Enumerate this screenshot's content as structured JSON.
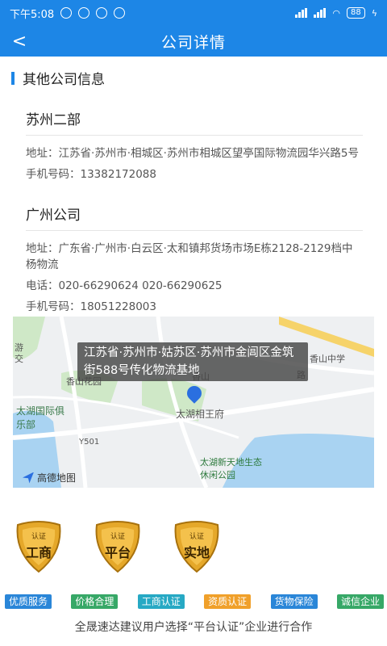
{
  "status_bar": {
    "time": "下午5:08",
    "battery": "88"
  },
  "header": {
    "back_label": "<",
    "title": "公司详情"
  },
  "section_title": "其他公司信息",
  "companies": [
    {
      "name": "苏州二部",
      "address_label": "地址：",
      "address": "江苏省·苏州市·相城区·苏州市相城区望亭国际物流园华兴路5号",
      "mobile_label": "手机号码：",
      "mobile": "13382172088"
    },
    {
      "name": "广州公司",
      "address_label": "地址：",
      "address": "广东省·广州市·白云区·太和镇邦货场市场E栋2128-2129档中杨物流",
      "phone_label": "电话：",
      "phone": "020-66290624 020-66290625",
      "mobile_label": "手机号码：",
      "mobile": "18051228003"
    }
  ],
  "map": {
    "bubble_text": "江苏省·苏州市·姑苏区·苏州市金阊区金筑街588号传化物流基地",
    "labels": {
      "xiangshan_garden": "香山花园",
      "xiangshan_school": "香山中学",
      "xiangwang": "太湖相王府",
      "club": "太湖国际俱乐部",
      "park": "太湖新天地生态休闲公园",
      "road": "Y501",
      "you": "游",
      "jiao": "交",
      "lu": "路",
      "xiangshan": "香山"
    },
    "logo_text": "高德地图",
    "colors": {
      "water": "#a9d3f2",
      "land": "#eef0f2",
      "green": "#cfe8c7",
      "road": "#ffffff",
      "highway": "#f6d36a"
    }
  },
  "badges": [
    {
      "top": "认证",
      "main": "工商"
    },
    {
      "top": "认证",
      "main": "平台"
    },
    {
      "top": "认证",
      "main": "实地"
    }
  ],
  "tags": [
    {
      "label": "优质服务",
      "color": "#2a86d8"
    },
    {
      "label": "价格合理",
      "color": "#37a867"
    },
    {
      "label": "工商认证",
      "color": "#27a9c4"
    },
    {
      "label": "资质认证",
      "color": "#f0a02a"
    },
    {
      "label": "货物保险",
      "color": "#2a86d8"
    },
    {
      "label": "诚信企业",
      "color": "#37a867"
    }
  ],
  "footer_note": "全晟速达建议用户选择“平台认证”企业进行合作",
  "accent_color": "#1d86e6"
}
